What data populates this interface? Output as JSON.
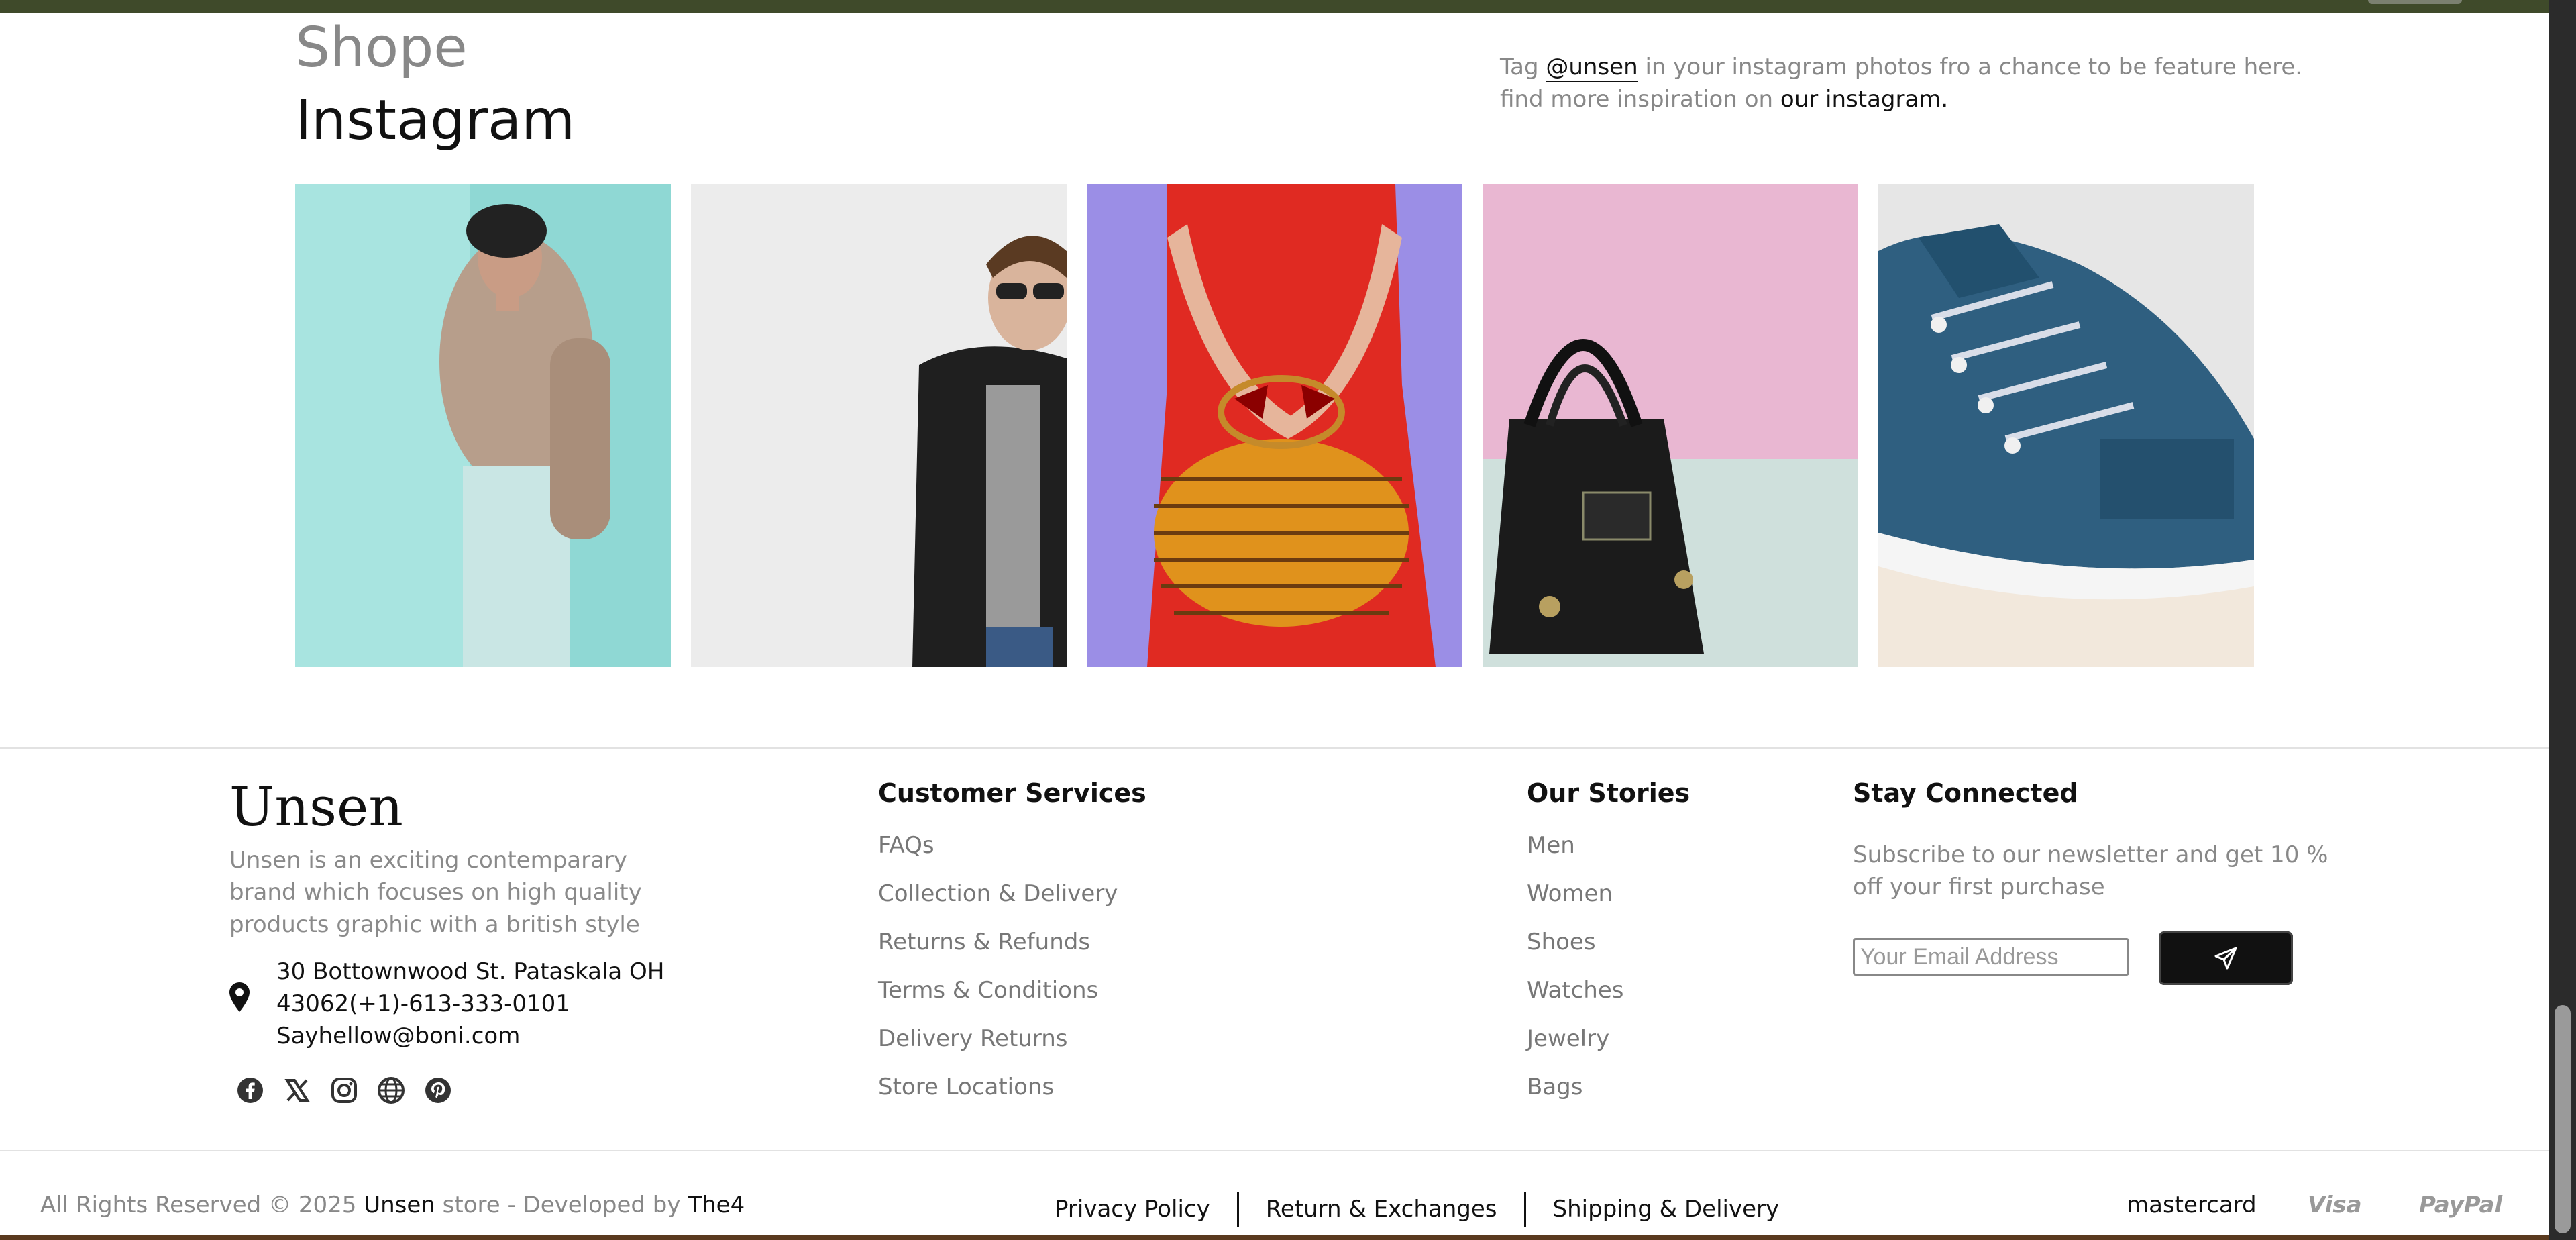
{
  "instagram": {
    "small_title": "Shope",
    "title": "Instagram",
    "tag_prefix": "Tag",
    "handle": "@unsen",
    "tag_suffix": "in your instagram photos fro a chance to be feature here.",
    "inspire_prefix": "find more inspiration on",
    "inspire_link": "our instagram.",
    "photos": [
      {
        "icon": "man-sweater-photo",
        "bg": "#a8e4e0"
      },
      {
        "icon": "man-leather-jacket-photo",
        "bg": "#ececec"
      },
      {
        "icon": "red-dress-bag-photo",
        "bg": "#9b8ee6"
      },
      {
        "icon": "black-handbag-photo",
        "bg": "#e9b7d2"
      },
      {
        "icon": "blue-sneaker-photo",
        "bg": "#e6e6e6"
      }
    ]
  },
  "footer": {
    "brand": "Unsen",
    "description": "Unsen is an exciting contemparary brand which focuses on high quality products graphic with a british style",
    "address_line1": "30 Bottownwood St. Pataskala OH",
    "address_line2": "43062(+1)-613-333-0101",
    "email": "Sayhellow@boni.com",
    "socials": [
      "facebook-icon",
      "x-icon",
      "instagram-icon",
      "globe-icon",
      "pinterest-icon"
    ],
    "customer_services": {
      "title": "Customer Services",
      "items": [
        "FAQs",
        "Collection & Delivery",
        "Returns & Refunds",
        "Terms & Conditions",
        "Delivery Returns",
        "Store Locations"
      ]
    },
    "our_stories": {
      "title": "Our Stories",
      "items": [
        "Men",
        "Women",
        "Shoes",
        "Watches",
        "Jewelry",
        "Bags"
      ]
    },
    "newsletter": {
      "title": "Stay Connected",
      "text": "Subscribe to our newsletter and get 10 % off your first purchase",
      "placeholder": "Your Email Address",
      "button_icon": "send-icon"
    }
  },
  "bottom": {
    "rights": "All Rights Reserved © 2025",
    "store": "Unsen",
    "store_suffix": "store - Developed by",
    "developer": "The4",
    "policies": [
      "Privacy Policy",
      "Return & Exchanges",
      "Shipping & Delivery"
    ],
    "payments": [
      "mastercard",
      "Visa",
      "PayPal"
    ]
  }
}
